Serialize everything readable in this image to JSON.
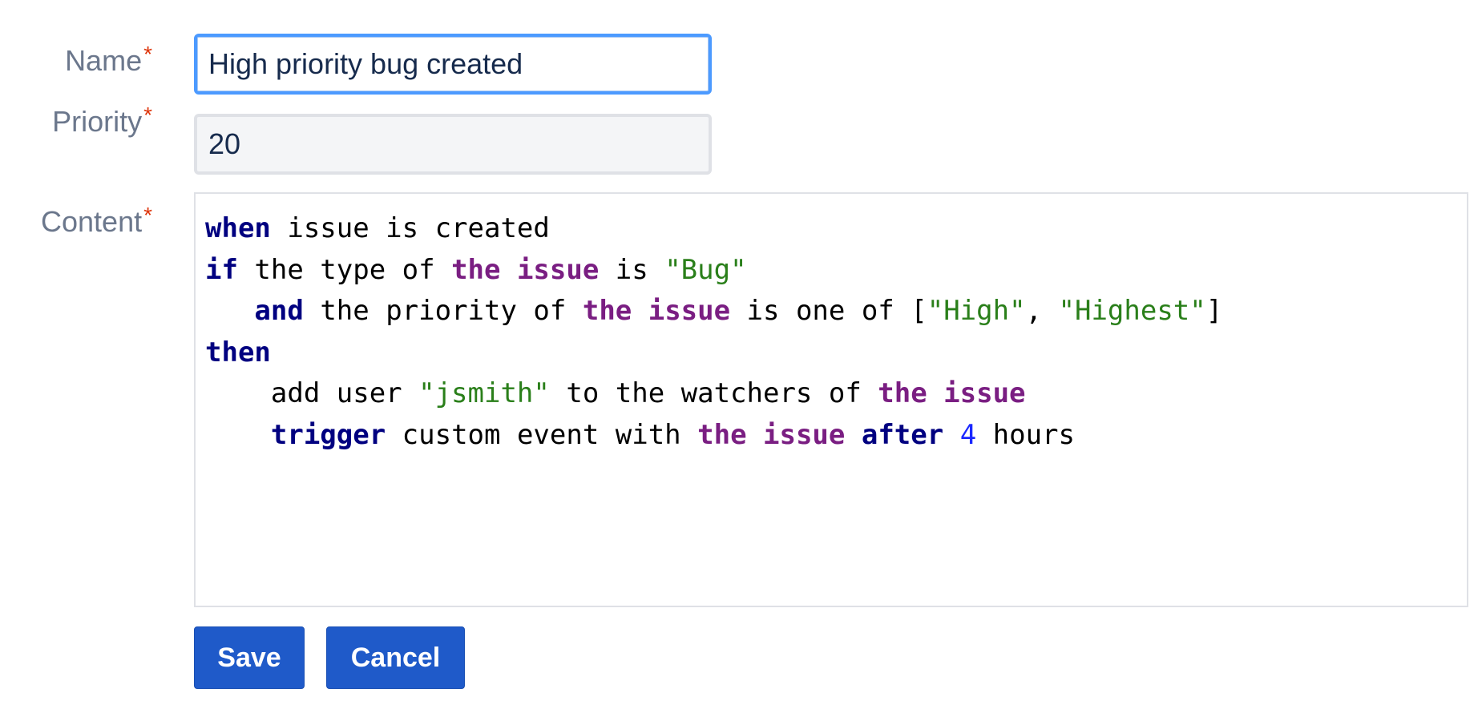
{
  "form": {
    "name": {
      "label": "Name",
      "required_mark": "*",
      "value": "High priority bug created"
    },
    "priority": {
      "label": "Priority",
      "required_mark": "*",
      "value": "20"
    },
    "content": {
      "label": "Content",
      "required_mark": "*",
      "lines": [
        [
          {
            "t": "when",
            "c": "kw"
          },
          {
            "t": " issue is created",
            "c": "tx"
          }
        ],
        [
          {
            "t": "if",
            "c": "kw"
          },
          {
            "t": " the type of ",
            "c": "tx"
          },
          {
            "t": "the issue",
            "c": "pr"
          },
          {
            "t": " is ",
            "c": "tx"
          },
          {
            "t": "\"Bug\"",
            "c": "st"
          }
        ],
        [
          {
            "t": "   ",
            "c": "tx"
          },
          {
            "t": "and",
            "c": "kw"
          },
          {
            "t": " the priority of ",
            "c": "tx"
          },
          {
            "t": "the issue",
            "c": "pr"
          },
          {
            "t": " is one of [",
            "c": "tx"
          },
          {
            "t": "\"High\"",
            "c": "st"
          },
          {
            "t": ", ",
            "c": "tx"
          },
          {
            "t": "\"Highest\"",
            "c": "st"
          },
          {
            "t": "]",
            "c": "tx"
          }
        ],
        [
          {
            "t": "then",
            "c": "kw"
          }
        ],
        [
          {
            "t": "    add user ",
            "c": "tx"
          },
          {
            "t": "\"jsmith\"",
            "c": "st"
          },
          {
            "t": " to the watchers of ",
            "c": "tx"
          },
          {
            "t": "the issue",
            "c": "pr"
          }
        ],
        [
          {
            "t": "    ",
            "c": "tx"
          },
          {
            "t": "trigger",
            "c": "kw"
          },
          {
            "t": " custom event with ",
            "c": "tx"
          },
          {
            "t": "the issue",
            "c": "pr"
          },
          {
            "t": " ",
            "c": "tx"
          },
          {
            "t": "after",
            "c": "kw"
          },
          {
            "t": " ",
            "c": "tx"
          },
          {
            "t": "4",
            "c": "nm"
          },
          {
            "t": " hours",
            "c": "tx"
          }
        ]
      ]
    }
  },
  "buttons": {
    "save_label": "Save",
    "cancel_label": "Cancel"
  },
  "colors": {
    "keyword": "#000080",
    "property": "#7a1e82",
    "string": "#2a7f1a",
    "number": "#1a28ff",
    "button": "#1f5ac9",
    "focus_border": "#4c9aff",
    "required": "#de350b"
  }
}
